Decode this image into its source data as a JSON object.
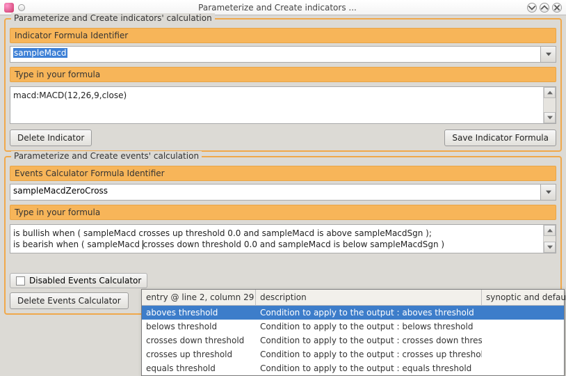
{
  "window": {
    "title": "Parameterize and Create indicators ..."
  },
  "indicators_group": {
    "title": "Parameterize and Create indicators' calculation",
    "identifier_label": "Indicator Formula Identifier",
    "identifier_value": "sampleMacd",
    "formula_label": "Type in your formula",
    "formula_value": "macd:MACD(12,26,9,close)",
    "delete_btn": "Delete Indicator",
    "save_btn": "Save Indicator Formula"
  },
  "events_group": {
    "title": "Parameterize and Create events' calculation",
    "identifier_label": "Events Calculator Formula Identifier",
    "identifier_value": "sampleMacdZeroCross",
    "formula_label": "Type in your formula",
    "formula_line1": "is bullish when ( sampleMacd crosses up threshold 0.0 and sampleMacd is above sampleMacdSgn );",
    "formula_line2_a": "is bearish when ( sampleMacd ",
    "formula_line2_b": "crosses down threshold 0.0 and sampleMacd is below sampleMacdSgn )",
    "disabled_checkbox_label": "Disabled Events Calculator",
    "delete_btn": "Delete Events Calculator"
  },
  "autocomplete": {
    "header_col0": "entry @ line 2, column 29",
    "header_col1": "description",
    "header_col2": "synoptic and defaul",
    "rows": [
      {
        "entry": "aboves threshold",
        "desc": "Condition to apply to the output : aboves threshold",
        "selected": true
      },
      {
        "entry": "belows threshold",
        "desc": "Condition to apply to the output : belows threshold",
        "selected": false
      },
      {
        "entry": "crosses down threshold",
        "desc": "Condition to apply to the output : crosses down threshold",
        "selected": false
      },
      {
        "entry": "crosses up threshold",
        "desc": "Condition to apply to the output : crosses up threshold",
        "selected": false
      },
      {
        "entry": "equals threshold",
        "desc": "Condition to apply to the output : equals threshold",
        "selected": false
      }
    ]
  }
}
